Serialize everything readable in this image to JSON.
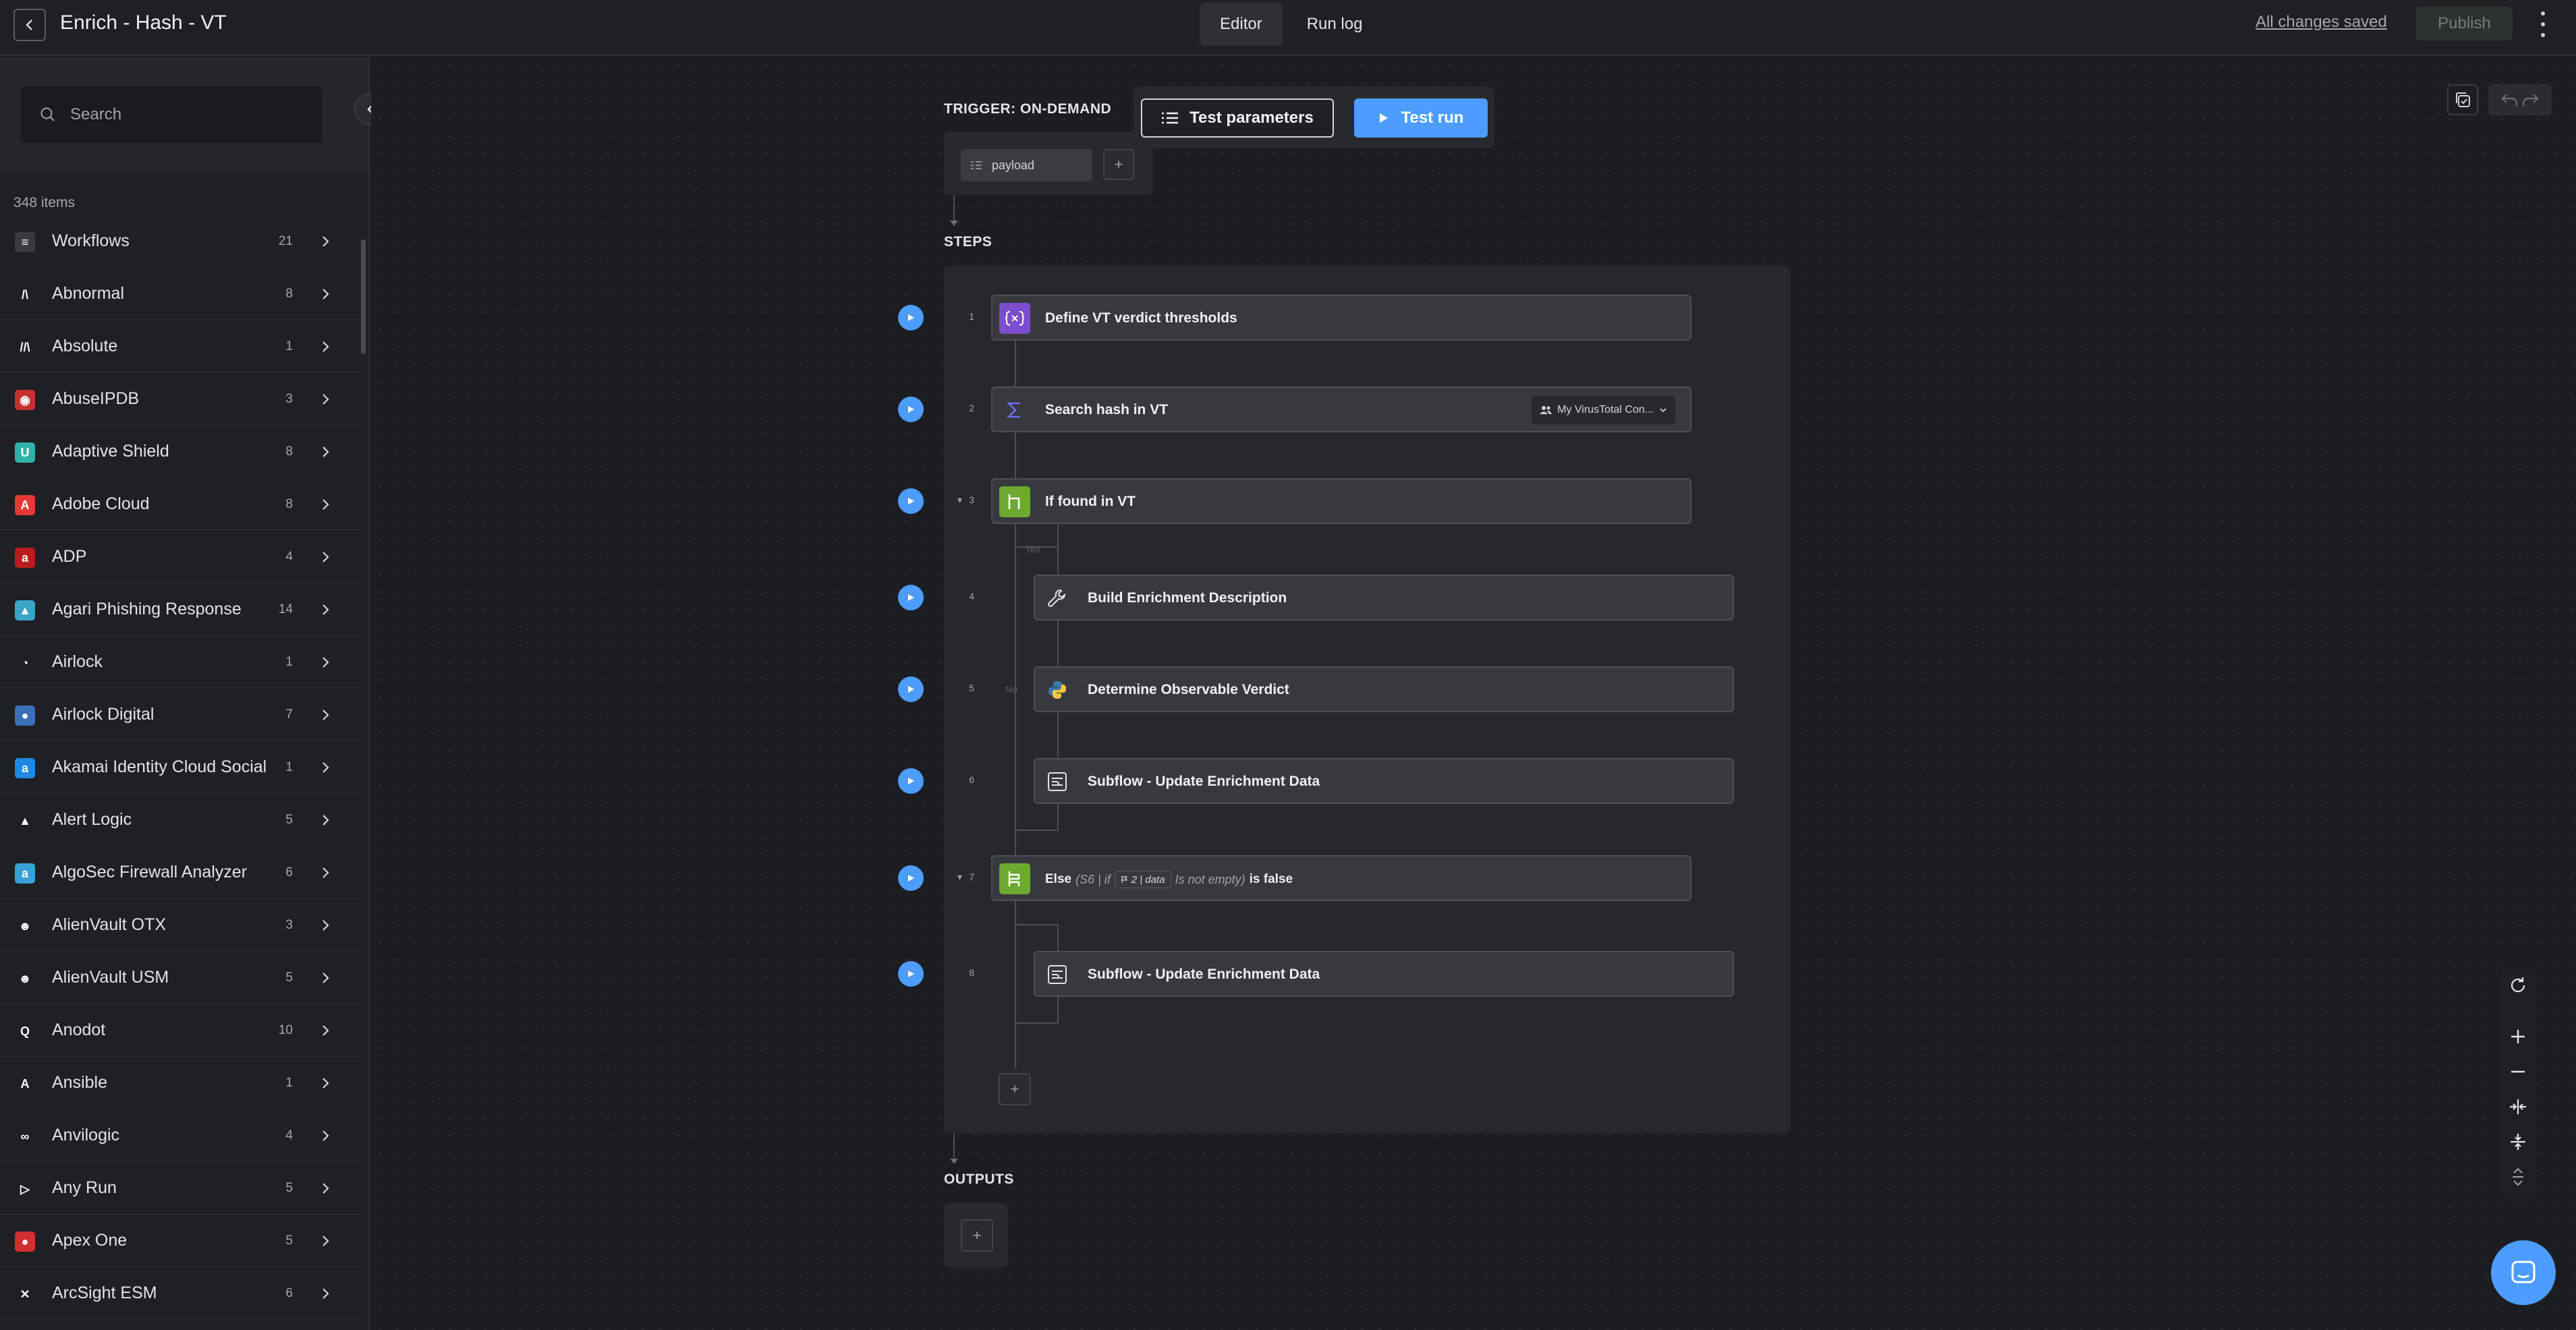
{
  "header": {
    "title": "Enrich - Hash - VT",
    "tabs": [
      {
        "label": "Editor",
        "active": true
      },
      {
        "label": "Run log",
        "active": false
      }
    ],
    "status": "All changes saved",
    "publish_label": "Publish"
  },
  "sidebar": {
    "search_placeholder": "Search",
    "items_count": "348 items",
    "items": [
      {
        "label": "Workflows",
        "count": "21",
        "icon": "workflows-icon",
        "color": "#3a3b41",
        "glyph": "≡"
      },
      {
        "label": "Abnormal",
        "count": "8",
        "icon": "abnormal-logo",
        "color": "#1f2024",
        "glyph": "/\\"
      },
      {
        "label": "Absolute",
        "count": "1",
        "icon": "absolute-logo",
        "color": "#1f2024",
        "glyph": "//\\"
      },
      {
        "label": "AbuseIPDB",
        "count": "3",
        "icon": "abuseipdb-logo",
        "color": "#c53030",
        "glyph": "◉"
      },
      {
        "label": "Adaptive Shield",
        "count": "8",
        "icon": "adaptive-shield-logo",
        "color": "#2fb3a8",
        "glyph": "U"
      },
      {
        "label": "Adobe Cloud",
        "count": "8",
        "icon": "adobe-cloud-logo",
        "color": "#e53935",
        "glyph": "A"
      },
      {
        "label": "ADP",
        "count": "4",
        "icon": "adp-logo",
        "color": "#b91c1c",
        "glyph": "a"
      },
      {
        "label": "Agari Phishing Response",
        "count": "14",
        "icon": "agari-logo",
        "color": "#3aa5c9",
        "glyph": "▲"
      },
      {
        "label": "Airlock",
        "count": "1",
        "icon": "airlock-logo",
        "color": "#1f2024",
        "glyph": "◔"
      },
      {
        "label": "Airlock Digital",
        "count": "7",
        "icon": "airlock-digital-logo",
        "color": "#3b6fb6",
        "glyph": "●"
      },
      {
        "label": "Akamai Identity Cloud Social",
        "count": "1",
        "icon": "akamai-logo",
        "color": "#1e88e5",
        "glyph": "a"
      },
      {
        "label": "Alert Logic",
        "count": "5",
        "icon": "alert-logic-logo",
        "color": "#1f2024",
        "glyph": "▲"
      },
      {
        "label": "AlgoSec Firewall Analyzer",
        "count": "6",
        "icon": "algosec-logo",
        "color": "#3aa0d8",
        "glyph": "a"
      },
      {
        "label": "AlienVault OTX",
        "count": "3",
        "icon": "alienvault-otx-logo",
        "color": "#1f2024",
        "glyph": "☻"
      },
      {
        "label": "AlienVault USM",
        "count": "5",
        "icon": "alienvault-usm-logo",
        "color": "#1f2024",
        "glyph": "☻"
      },
      {
        "label": "Anodot",
        "count": "10",
        "icon": "anodot-logo",
        "color": "#1f2024",
        "glyph": "Q"
      },
      {
        "label": "Ansible",
        "count": "1",
        "icon": "ansible-logo",
        "color": "#1f2024",
        "glyph": "A"
      },
      {
        "label": "Anvilogic",
        "count": "4",
        "icon": "anvilogic-logo",
        "color": "#1f2024",
        "glyph": "∞"
      },
      {
        "label": "Any Run",
        "count": "5",
        "icon": "any-run-logo",
        "color": "#1f2024",
        "glyph": "▷"
      },
      {
        "label": "Apex One",
        "count": "5",
        "icon": "apex-one-logo",
        "color": "#d32f2f",
        "glyph": "●"
      },
      {
        "label": "ArcSight ESM",
        "count": "6",
        "icon": "arcsight-logo",
        "color": "#1f2024",
        "glyph": "✕"
      }
    ]
  },
  "canvas": {
    "trigger_label": "TRIGGER: ON-DEMAND",
    "payload_label": "payload",
    "test_params_label": "Test parameters",
    "test_run_label": "Test run",
    "steps_label": "STEPS",
    "outputs_label": "OUTPUTS",
    "plus": "+",
    "branch_yes": "Yes",
    "branch_no": "No",
    "steps": [
      {
        "num": "1",
        "title": "Define VT verdict thresholds",
        "icon": "variable-icon",
        "icon_color": "#7c4dcc"
      },
      {
        "num": "2",
        "title": "Search hash in VT",
        "icon": "sigma-icon",
        "icon_color": "#38393f",
        "connection": "My VirusTotal Con..."
      },
      {
        "num": "3",
        "title": "If found in VT",
        "icon": "branch-if-icon",
        "icon_color": "#6da82f"
      },
      {
        "num": "4",
        "title": "Build Enrichment Description",
        "icon": "wrench-icon",
        "icon_color": "#38393f"
      },
      {
        "num": "5",
        "title": "Determine Observable Verdict",
        "icon": "python-icon",
        "icon_color": "#38393f"
      },
      {
        "num": "6",
        "title": "Subflow - Update Enrichment Data",
        "icon": "subflow-icon",
        "icon_color": "#38393f"
      },
      {
        "num": "7",
        "title": "Else",
        "icon": "branch-else-icon",
        "icon_color": "#6da82f",
        "else_prefix": "(S6 | if",
        "else_chip": "2 | data",
        "else_condition": "Is not empty)",
        "else_suffix": "is false"
      },
      {
        "num": "8",
        "title": "Subflow - Update Enrichment Data",
        "icon": "subflow-icon",
        "icon_color": "#38393f"
      }
    ]
  },
  "colors": {
    "accent": "#4c9dff",
    "if_green": "#6da82f",
    "variable_purple": "#7c4dcc"
  }
}
